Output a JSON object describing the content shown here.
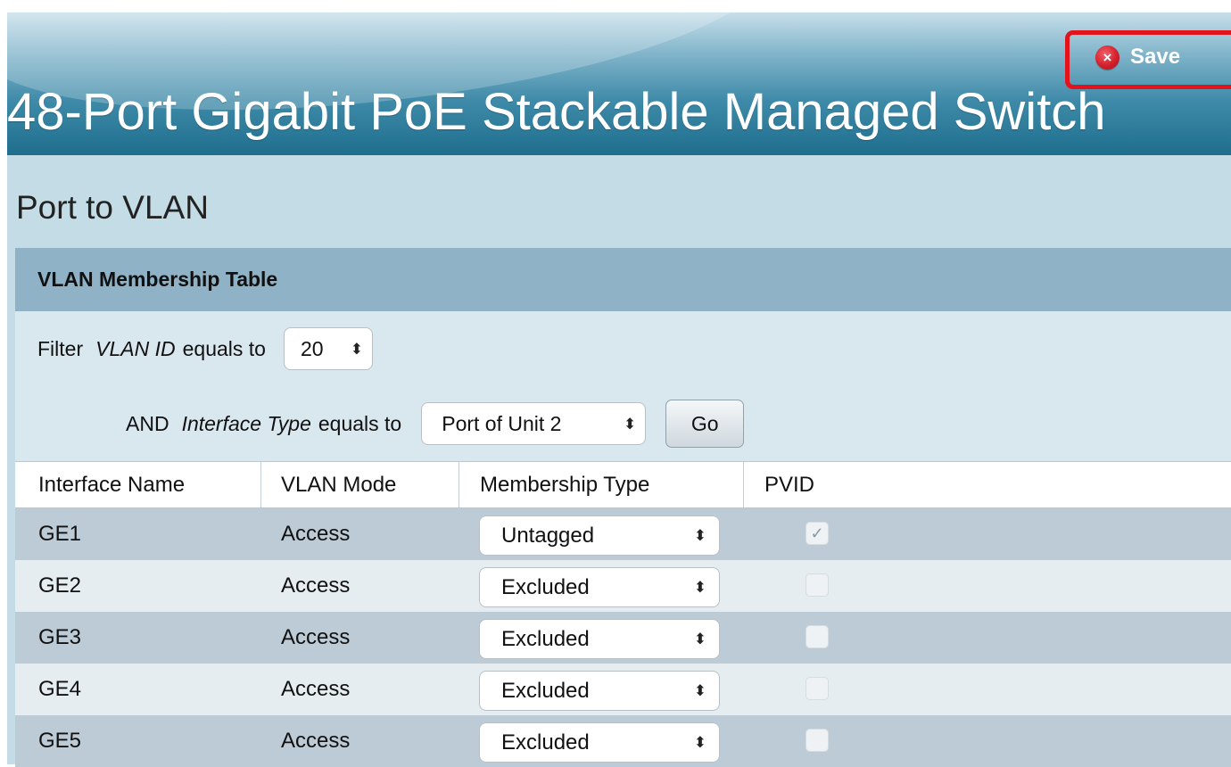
{
  "header": {
    "product_title": "48-Port Gigabit PoE Stackable Managed Switch",
    "save_label": "Save",
    "save_icon": "close-circle-icon",
    "save_icon_glyph": "×",
    "highlight_color": "#e3131b"
  },
  "page": {
    "title": "Port to VLAN"
  },
  "table": {
    "title": "VLAN Membership Table",
    "filter": {
      "label_filter": "Filter",
      "vlan_id_label": "VLAN ID",
      "equals_to": "equals to",
      "vlan_id_value": "20",
      "and_label": "AND",
      "interface_type_label": "Interface Type",
      "interface_type_equals": "equals to",
      "interface_type_value": "Port of Unit 2",
      "go_label": "Go"
    },
    "columns": [
      "Interface Name",
      "VLAN Mode",
      "Membership Type",
      "PVID"
    ],
    "rows": [
      {
        "interface": "GE1",
        "mode": "Access",
        "membership": "Untagged",
        "pvid": true
      },
      {
        "interface": "GE2",
        "mode": "Access",
        "membership": "Excluded",
        "pvid": false
      },
      {
        "interface": "GE3",
        "mode": "Access",
        "membership": "Excluded",
        "pvid": false
      },
      {
        "interface": "GE4",
        "mode": "Access",
        "membership": "Excluded",
        "pvid": false
      },
      {
        "interface": "GE5",
        "mode": "Access",
        "membership": "Excluded",
        "pvid": false
      }
    ]
  },
  "glyphs": {
    "select_arrows": "⬍",
    "checkmark": "✓"
  }
}
